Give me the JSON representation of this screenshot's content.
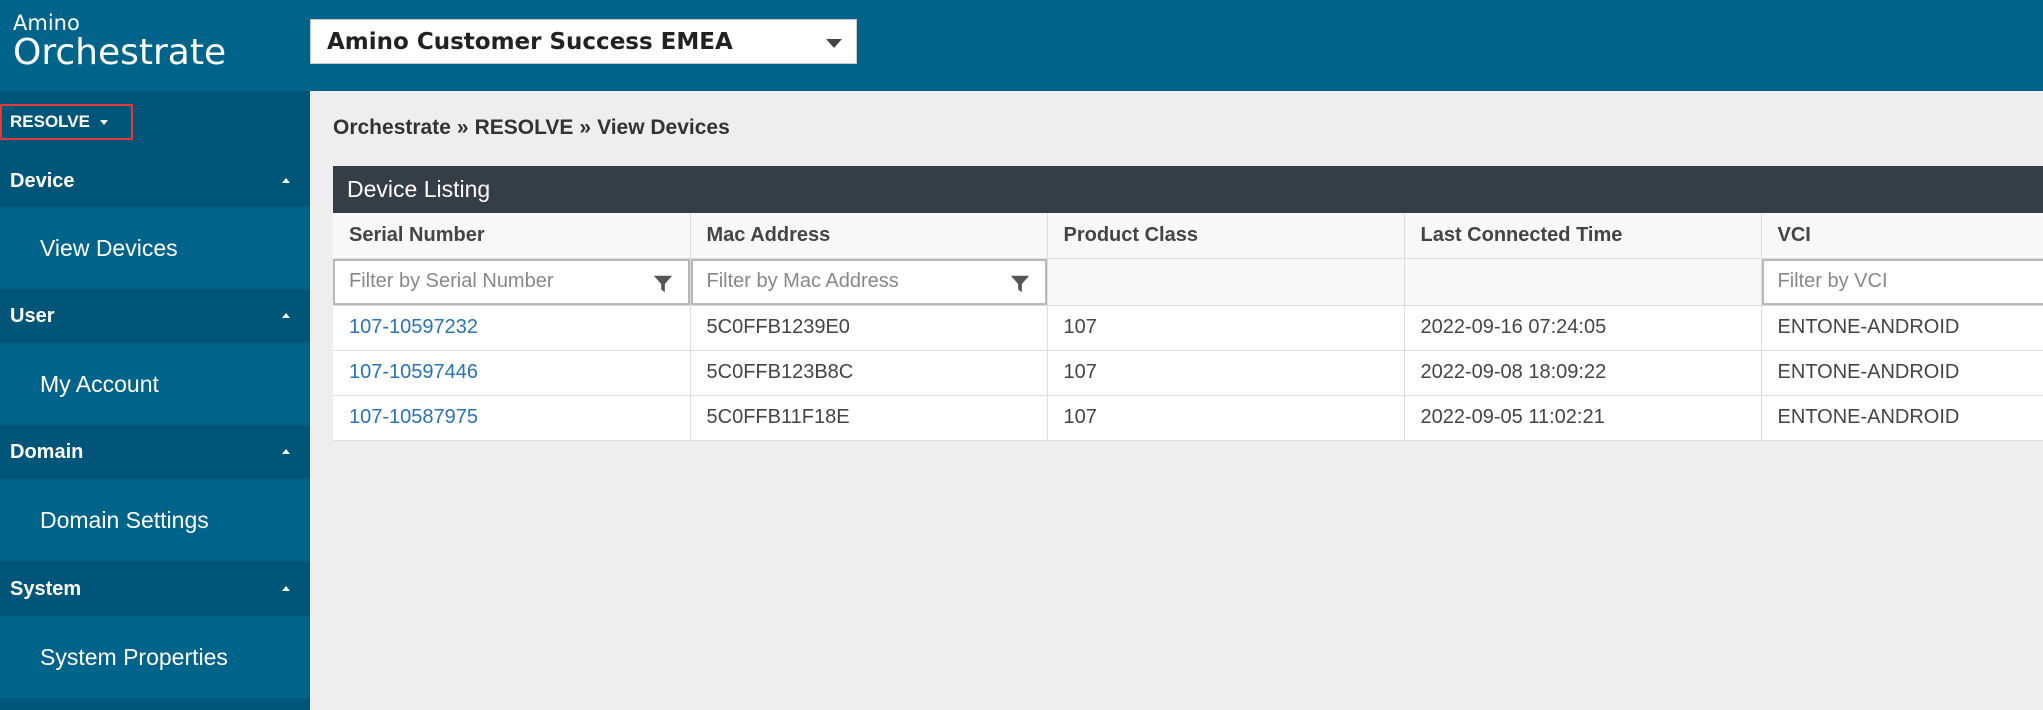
{
  "logo": {
    "line1": "Amino",
    "line2": "Orchestrate"
  },
  "domain_select": {
    "value": "Amino Customer Success EMEA"
  },
  "sidebar": {
    "menu_button": "RESOLVE",
    "sections": [
      {
        "label": "Device",
        "item": "View Devices"
      },
      {
        "label": "User",
        "item": "My Account"
      },
      {
        "label": "Domain",
        "item": "Domain Settings"
      },
      {
        "label": "System",
        "item": "System Properties"
      }
    ]
  },
  "breadcrumb": {
    "items": [
      "Orchestrate",
      "RESOLVE",
      "View Devices"
    ],
    "separator": "»"
  },
  "device_listing": {
    "title": "Device Listing",
    "columns": [
      "Serial Number",
      "Mac Address",
      "Product Class",
      "Last Connected Time",
      "VCI"
    ],
    "filters": {
      "serial_placeholder": "Filter by Serial Number",
      "mac_placeholder": "Filter by Mac Address",
      "vci_placeholder": "Filter by VCI"
    },
    "rows": [
      {
        "serial": "107-10597232",
        "mac": "5C0FFB1239E0",
        "product_class": "107",
        "last_connected": "2022-09-16 07:24:05",
        "vci": "ENTONE-ANDROID"
      },
      {
        "serial": "107-10597446",
        "mac": "5C0FFB123B8C",
        "product_class": "107",
        "last_connected": "2022-09-08 18:09:22",
        "vci": "ENTONE-ANDROID"
      },
      {
        "serial": "107-10587975",
        "mac": "5C0FFB11F18E",
        "product_class": "107",
        "last_connected": "2022-09-05 11:02:21",
        "vci": "ENTONE-ANDROID"
      }
    ]
  },
  "colors": {
    "header": "#00648a",
    "sidebar": "#005578",
    "panel_head": "#353d47",
    "link": "#2a73b5",
    "highlight": "#e53935"
  }
}
